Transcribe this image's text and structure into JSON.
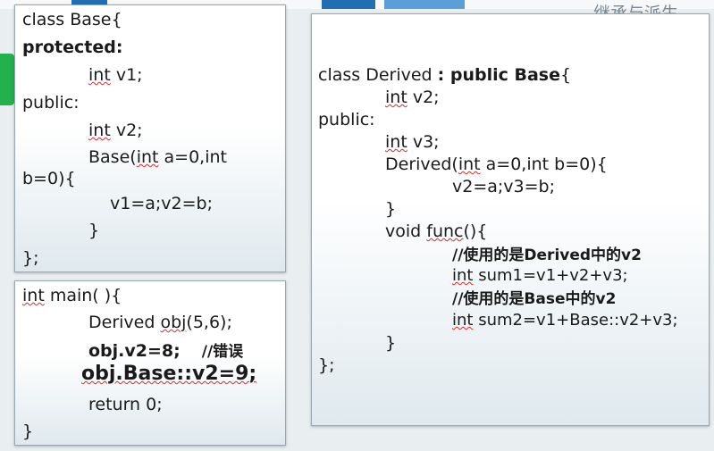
{
  "header": {
    "corner_title": "继承与派生"
  },
  "base_panel": {
    "lines": [
      "class Base{",
      "protected:",
      "int v1;",
      "public:",
      "int v2;",
      "Base(int a=0,int",
      "b=0){",
      "v1=a;v2=b;",
      "}",
      "};"
    ],
    "squiggle_words": [
      "int",
      "int",
      "int"
    ]
  },
  "main_panel": {
    "line0_kw": "int",
    "line0_rest": " main( ){",
    "line1_a": "Derived ",
    "line1_kw": "obj",
    "line1_b": "(5,6);",
    "line2_code": "obj.v2=8;",
    "line2_comment": "//错误",
    "line3": "obj.Base::v2=9;",
    "line4": "return 0;",
    "line5": "}"
  },
  "derived_panel": {
    "l0_a": "class Derived ",
    "l0_b": ": public Base",
    "l0_c": "{",
    "l1_kw": "int",
    "l1_rest": " v2;",
    "l2": "public:",
    "l3_kw": "int",
    "l3_rest": " v3;",
    "l4_a": "Derived(",
    "l4_kw": "int",
    "l4_b": " a=0,int b=0){",
    "l5": "v2=a;v3=b;",
    "l6": "}",
    "l7_a": "void ",
    "l7_kw": "func",
    "l7_b": "(){",
    "l8": "//使用的是Derived中的v2",
    "l9_kw": "int",
    "l9_rest": " sum1=v1+v2+v3;",
    "l10": "//使用的是Base中的v2",
    "l11_kw": "int",
    "l11_rest": " sum2=v1+Base::v2+v3;",
    "l12": "}",
    "l13": "};"
  },
  "colors": {
    "accent_green": "#22b14c",
    "squiggle": "#d62d2d"
  }
}
